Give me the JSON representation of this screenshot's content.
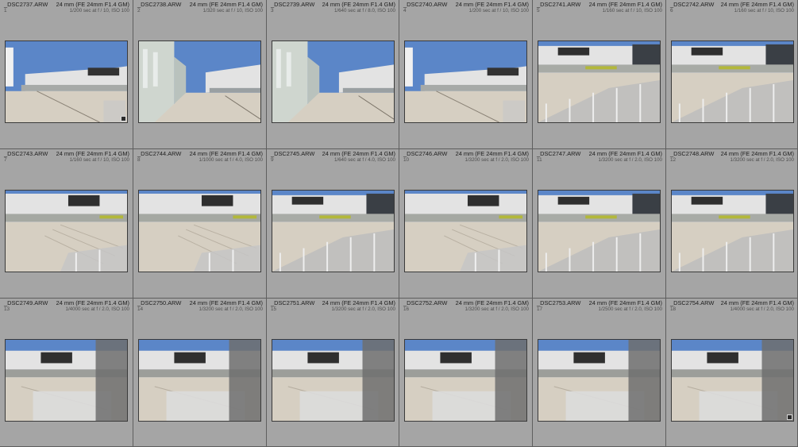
{
  "colors": {
    "cell_bg": "#a5a5a5",
    "sky": "#5b86c8",
    "building": "#e3e3e3",
    "plaza": "#d6cfc2"
  },
  "thumbnails": [
    {
      "file": "_DSC2737.ARW",
      "index": "1",
      "lens": "24 mm (FE 24mm F1.4 GM)",
      "exposure": "1/200 sec at f / 10, ISO 100",
      "scene": "wide",
      "badge": true
    },
    {
      "file": "_DSC2738.ARW",
      "index": "2",
      "lens": "24 mm (FE 24mm F1.4 GM)",
      "exposure": "1/320 sec at f / 10, ISO 100",
      "scene": "alley",
      "badge": false
    },
    {
      "file": "_DSC2739.ARW",
      "index": "3",
      "lens": "24 mm (FE 24mm F1.4 GM)",
      "exposure": "1/640 sec at f / 8.0, ISO 100",
      "scene": "alley",
      "badge": false
    },
    {
      "file": "_DSC2740.ARW",
      "index": "4",
      "lens": "24 mm (FE 24mm F1.4 GM)",
      "exposure": "1/200 sec at f / 10, ISO 100",
      "scene": "wide",
      "badge": false
    },
    {
      "file": "_DSC2741.ARW",
      "index": "5",
      "lens": "24 mm (FE 24mm F1.4 GM)",
      "exposure": "1/160 sec at f / 10, ISO 100",
      "scene": "rail",
      "badge": false
    },
    {
      "file": "_DSC2742.ARW",
      "index": "6",
      "lens": "24 mm (FE 24mm F1.4 GM)",
      "exposure": "1/160 sec at f / 10, ISO 100",
      "scene": "rail",
      "badge": false
    },
    {
      "file": "_DSC2743.ARW",
      "index": "7",
      "lens": "24 mm (FE 24mm F1.4 GM)",
      "exposure": "1/160 sec at f / 10, ISO 100",
      "scene": "steps",
      "badge": false
    },
    {
      "file": "_DSC2744.ARW",
      "index": "8",
      "lens": "24 mm (FE 24mm F1.4 GM)",
      "exposure": "1/1000 sec at f / 4.0, ISO 100",
      "scene": "steps",
      "badge": false
    },
    {
      "file": "_DSC2745.ARW",
      "index": "9",
      "lens": "24 mm (FE 24mm F1.4 GM)",
      "exposure": "1/640 sec at f / 4.0, ISO 100",
      "scene": "rail",
      "badge": false
    },
    {
      "file": "_DSC2746.ARW",
      "index": "10",
      "lens": "24 mm (FE 24mm F1.4 GM)",
      "exposure": "1/3200 sec at f / 2.0, ISO 100",
      "scene": "steps",
      "badge": false
    },
    {
      "file": "_DSC2747.ARW",
      "index": "11",
      "lens": "24 mm (FE 24mm F1.4 GM)",
      "exposure": "1/3200 sec at f / 2.0, ISO 100",
      "scene": "rail",
      "badge": false
    },
    {
      "file": "_DSC2748.ARW",
      "index": "12",
      "lens": "24 mm (FE 24mm F1.4 GM)",
      "exposure": "1/3200 sec at f / 2.0, ISO 100",
      "scene": "rail",
      "badge": false
    },
    {
      "file": "_DSC2749.ARW",
      "index": "13",
      "lens": "24 mm (FE 24mm F1.4 GM)",
      "exposure": "1/4000 sec at f / 2.0, ISO 100",
      "scene": "blur",
      "badge": false
    },
    {
      "file": "_DSC2750.ARW",
      "index": "14",
      "lens": "24 mm (FE 24mm F1.4 GM)",
      "exposure": "1/3200 sec at f / 2.0, ISO 100",
      "scene": "blur",
      "badge": false
    },
    {
      "file": "_DSC2751.ARW",
      "index": "15",
      "lens": "24 mm (FE 24mm F1.4 GM)",
      "exposure": "1/3200 sec at f / 2.0, ISO 100",
      "scene": "blur",
      "badge": false
    },
    {
      "file": "_DSC2752.ARW",
      "index": "16",
      "lens": "24 mm (FE 24mm F1.4 GM)",
      "exposure": "1/3200 sec at f / 2.0, ISO 100",
      "scene": "blur",
      "badge": false
    },
    {
      "file": "_DSC2753.ARW",
      "index": "17",
      "lens": "24 mm (FE 24mm F1.4 GM)",
      "exposure": "1/2500 sec at f / 2.0, ISO 100",
      "scene": "blur",
      "badge": false
    },
    {
      "file": "_DSC2754.ARW",
      "index": "18",
      "lens": "24 mm (FE 24mm F1.4 GM)",
      "exposure": "1/4000 sec at f / 2.0, ISO 100",
      "scene": "blur",
      "badge": true
    }
  ]
}
